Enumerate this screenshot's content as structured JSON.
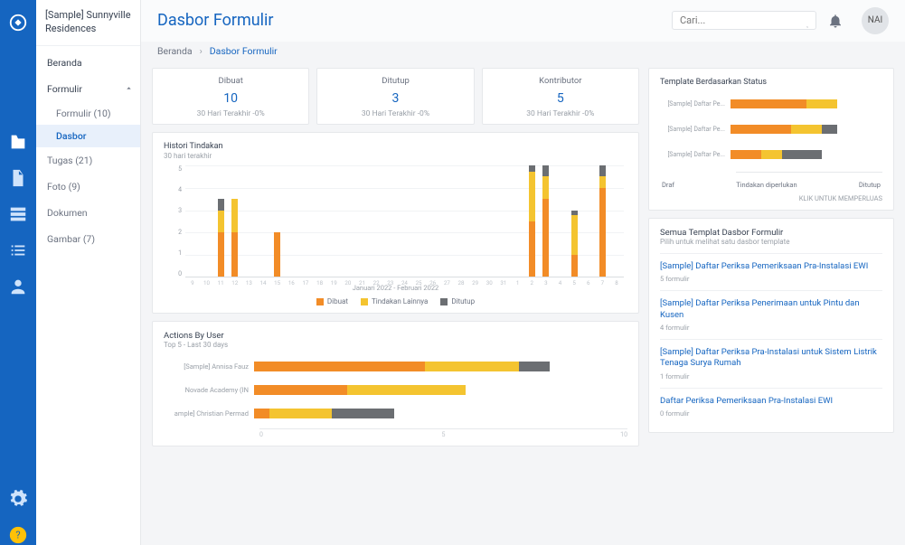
{
  "project_name": "[Sample] Sunnyville Residences",
  "search": {
    "placeholder": "Cari..."
  },
  "avatar_initials": "NAI",
  "page_title": "Dasbor Formulir",
  "breadcrumb": {
    "home": "Beranda",
    "current": "Dasbor Formulir"
  },
  "sidebar": {
    "beranda": "Beranda",
    "formulir": "Formulir",
    "formulir_count": "Formulir (10)",
    "dasbor": "Dasbor",
    "tugas": "Tugas (21)",
    "foto": "Foto (9)",
    "dokumen": "Dokumen",
    "gambar": "Gambar (7)"
  },
  "kpis": [
    {
      "label": "Dibuat",
      "value": "10",
      "foot": "30 Hari Terakhir -0%"
    },
    {
      "label": "Ditutup",
      "value": "3",
      "foot": "30 Hari Terakhir -0%"
    },
    {
      "label": "Kontributor",
      "value": "5",
      "foot": "30 Hari Terakhir -0%"
    }
  ],
  "histori": {
    "title": "Histori Tindakan",
    "sub": "30 hari terakhir",
    "xlabel": "Januari 2022 - Februari 2022",
    "legend": [
      "Dibuat",
      "Tindakan Lainnya",
      "Ditutup"
    ]
  },
  "abu": {
    "title": "Actions By User",
    "sub": "Top 5 - Last 30 days"
  },
  "tpl_status": {
    "title": "Template Berdasarkan Status",
    "legend": [
      "Draf",
      "Tindakan diperlukan",
      "Ditutup"
    ],
    "foot": "KLIK UNTUK MEMPERLUAS"
  },
  "tpl_list": {
    "title": "Semua Templat Dasbor Formulir",
    "sub": "Pilih untuk melihat satu dasbor template",
    "items": [
      {
        "name": "[Sample] Daftar Periksa Pemeriksaan Pra-Instalasi EWI",
        "meta": "5 formulir"
      },
      {
        "name": "[Sample] Daftar Periksa Penerimaan untuk Pintu dan Kusen",
        "meta": "4 formulir"
      },
      {
        "name": "[Sample] Daftar Periksa Pra-Instalasi untuk Sistem Listrik Tenaga Surya Rumah",
        "meta": "1 formulir"
      },
      {
        "name": "Daftar Periksa Pemeriksaan Pra-Instalasi EWI",
        "meta": "0 formulir"
      }
    ]
  },
  "chart_data": [
    {
      "type": "bar",
      "id": "histori_tindakan",
      "title": "Histori Tindakan",
      "xlabel": "Januari 2022 - Februari 2022",
      "ylabel": "",
      "ylim": [
        0,
        5
      ],
      "categories": [
        "9",
        "10",
        "11",
        "12",
        "13",
        "14",
        "15",
        "16",
        "17",
        "18",
        "19",
        "20",
        "21",
        "22",
        "23",
        "24",
        "25",
        "26",
        "27",
        "28",
        "29",
        "30",
        "31",
        "1",
        "2",
        "3",
        "4",
        "5",
        "6",
        "7",
        "8"
      ],
      "series": [
        {
          "name": "Dibuat",
          "values": [
            0,
            0,
            2,
            2,
            0,
            0,
            2,
            0,
            0,
            0,
            0,
            0,
            0,
            0,
            0,
            0,
            0,
            0,
            0,
            0,
            0,
            0,
            0,
            0,
            2.5,
            3.5,
            0,
            1,
            0,
            4,
            0
          ]
        },
        {
          "name": "Tindakan Lainnya",
          "values": [
            0,
            0,
            1,
            1.5,
            0,
            0,
            0,
            0,
            0,
            0,
            0,
            0,
            0,
            0,
            0,
            0,
            0,
            0,
            0,
            0,
            0,
            0,
            0,
            0,
            2.2,
            1,
            0,
            1.8,
            0,
            0.5,
            0
          ]
        },
        {
          "name": "Ditutup",
          "values": [
            0,
            0,
            0.5,
            0,
            0,
            0,
            0,
            0,
            0,
            0,
            0,
            0,
            0,
            0,
            0,
            0,
            0,
            0,
            0,
            0,
            0,
            0,
            0,
            0,
            0.3,
            0.5,
            0,
            0.2,
            0,
            0.5,
            0
          ]
        }
      ]
    },
    {
      "type": "bar",
      "id": "actions_by_user",
      "title": "Actions By User",
      "orientation": "horizontal",
      "xlim": [
        0,
        12
      ],
      "categories": [
        "[Sample] Annisa Fauz",
        "Novade Academy (IN",
        "ample] Christian Permad"
      ],
      "series": [
        {
          "name": "Dibuat",
          "values": [
            5.5,
            3.0,
            0.5
          ]
        },
        {
          "name": "Tindakan Lainnya",
          "values": [
            3.0,
            3.8,
            2.0
          ]
        },
        {
          "name": "Ditutup",
          "values": [
            1.0,
            0.0,
            2.0
          ]
        }
      ]
    },
    {
      "type": "bar",
      "id": "template_status",
      "title": "Template Berdasarkan Status",
      "orientation": "horizontal",
      "xlim": [
        0,
        5
      ],
      "categories": [
        "[Sample] Daftar Pe...",
        "[Sample] Daftar Pe...",
        "[Sample] Daftar Pe..."
      ],
      "series": [
        {
          "name": "Draf",
          "values": [
            2.5,
            2.0,
            1.0
          ]
        },
        {
          "name": "Tindakan diperlukan",
          "values": [
            1.0,
            1.0,
            0.7
          ]
        },
        {
          "name": "Ditutup",
          "values": [
            0.0,
            0.5,
            1.3
          ]
        }
      ]
    }
  ]
}
